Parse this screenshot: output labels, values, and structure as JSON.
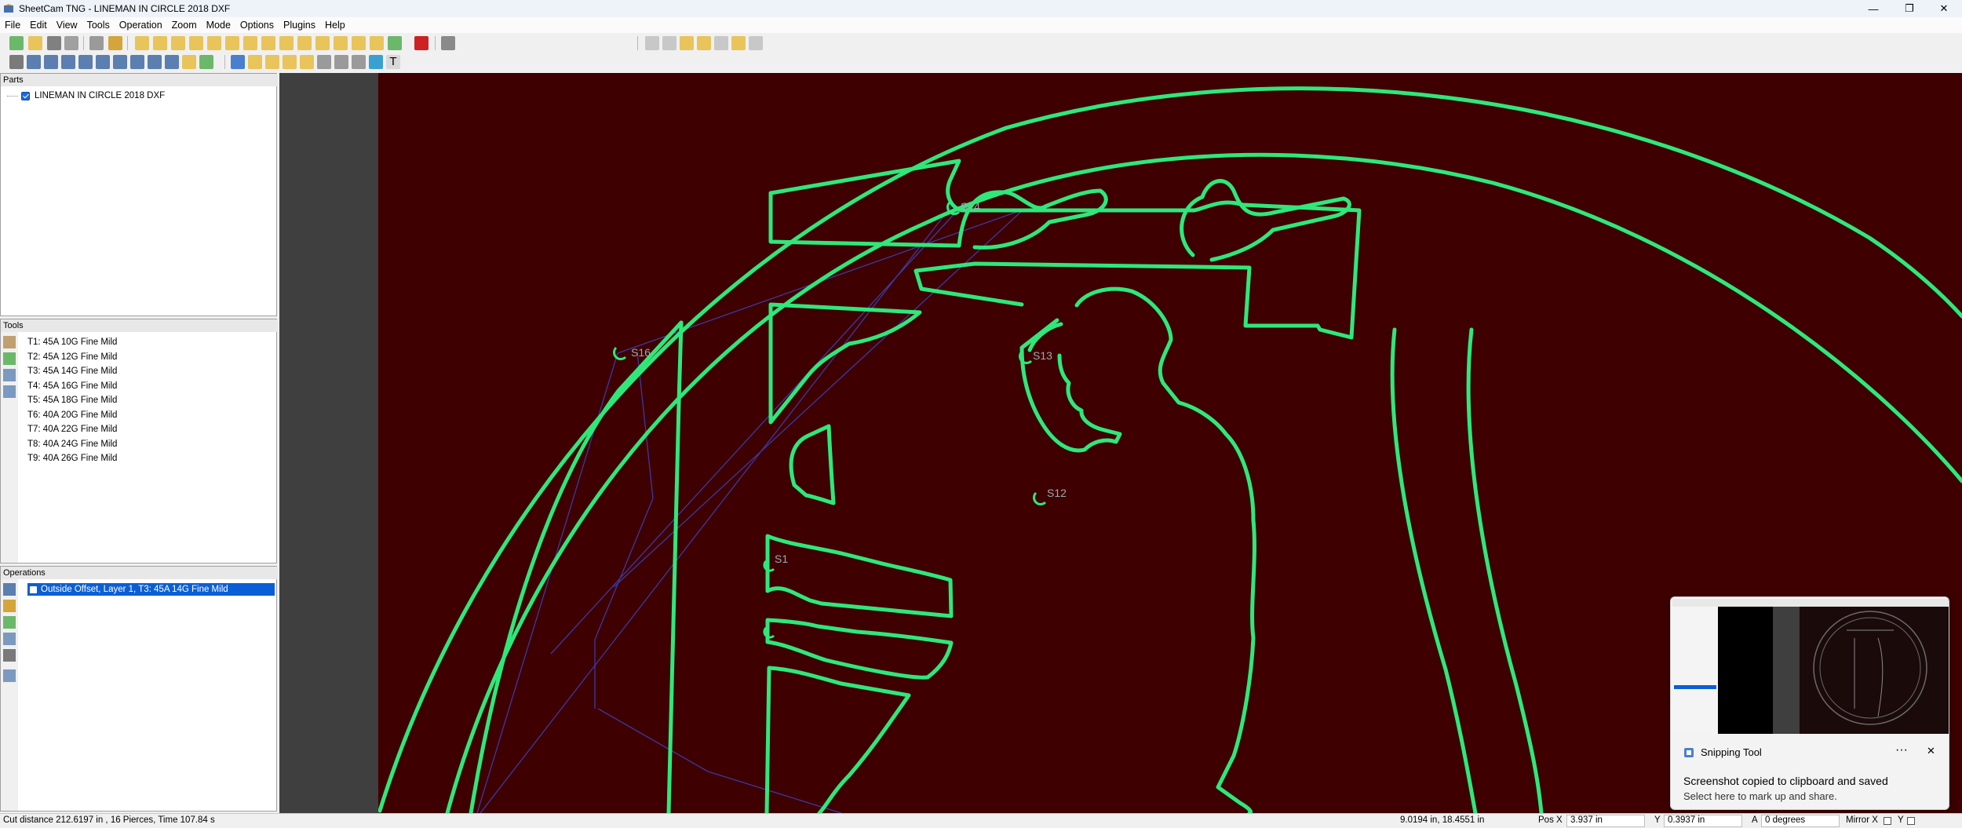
{
  "window": {
    "title": "SheetCam TNG - LINEMAN IN CIRCLE 2018 DXF",
    "minimize_glyph": "—",
    "maximize_glyph": "❐",
    "close_glyph": "✕"
  },
  "menu": [
    "File",
    "Edit",
    "View",
    "Tools",
    "Operation",
    "Zoom",
    "Mode",
    "Options",
    "Plugins",
    "Help"
  ],
  "parts_panel": {
    "header": "Parts",
    "items": [
      {
        "label": "LINEMAN IN CIRCLE 2018 DXF",
        "checked": true
      }
    ]
  },
  "tools_panel": {
    "header": "Tools",
    "items": [
      "T1: 45A 10G Fine Mild",
      "T2: 45A 12G Fine Mild",
      "T3: 45A 14G Fine Mild",
      "T4: 45A 16G Fine Mild",
      "T5: 45A 18G Fine Mild",
      "T6: 40A 20G Fine Mild",
      "T7: 40A 22G Fine Mild",
      "T8: 40A 24G Fine Mild",
      "T9: 40A 26G Fine Mild"
    ]
  },
  "operations_panel": {
    "header": "Operations",
    "items": [
      {
        "label": "Outside Offset, Layer 1, T3: 45A 14G Fine Mild",
        "checked": true,
        "selected": true
      }
    ]
  },
  "canvas": {
    "background": "#3e0000",
    "path_color": "#2ee87a",
    "rapid_color": "#3a3aa0",
    "labels": [
      "S16",
      "S14",
      "S13",
      "S12",
      "S1"
    ]
  },
  "statusbar": {
    "cut_info": "Cut distance 212.6197 in , 16 Pierces, Time 107.84 s",
    "cursor": "9.0194 in, 18.4551 in",
    "pos_x_label": "Pos X",
    "pos_x_value": "3.937 in",
    "y_label": "Y",
    "y_value": "0.3937 in",
    "a_label": "A",
    "a_value": "0 degrees",
    "mirror_label": "Mirror X",
    "mirror_y_label": "Y"
  },
  "toast": {
    "app_name": "Snipping Tool",
    "more_glyph": "···",
    "close_glyph": "✕",
    "title": "Screenshot copied to clipboard and saved",
    "subtitle": "Select here to mark up and share."
  }
}
